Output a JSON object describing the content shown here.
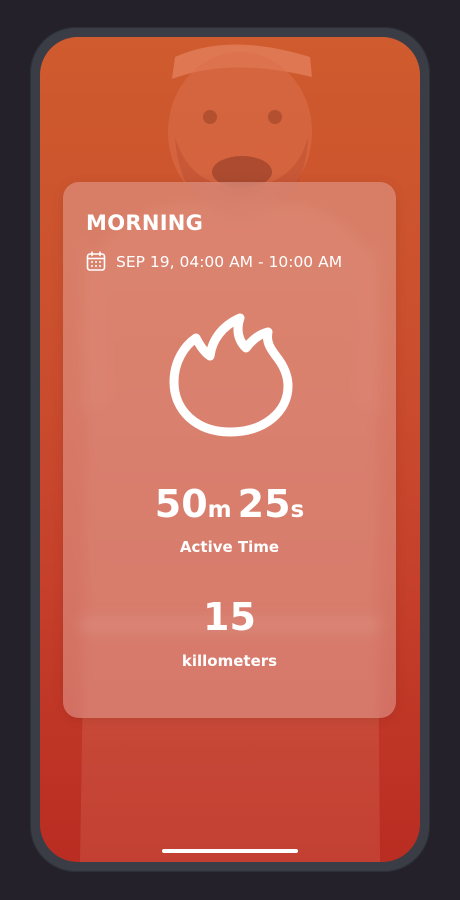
{
  "card": {
    "title": "MORNING",
    "date_range": "SEP 19, 04:00 AM - 10:00 AM",
    "icon": "flame-icon"
  },
  "stats": {
    "minutes": "50",
    "minutes_unit": "m",
    "seconds": "25",
    "seconds_unit": "s",
    "time_label": "Active Time",
    "distance": "15",
    "distance_label": "killometers"
  },
  "colors": {
    "background": "#24212a",
    "device_frame": "#3a3d45",
    "accent": "#c8562c",
    "text": "#ffffff"
  }
}
